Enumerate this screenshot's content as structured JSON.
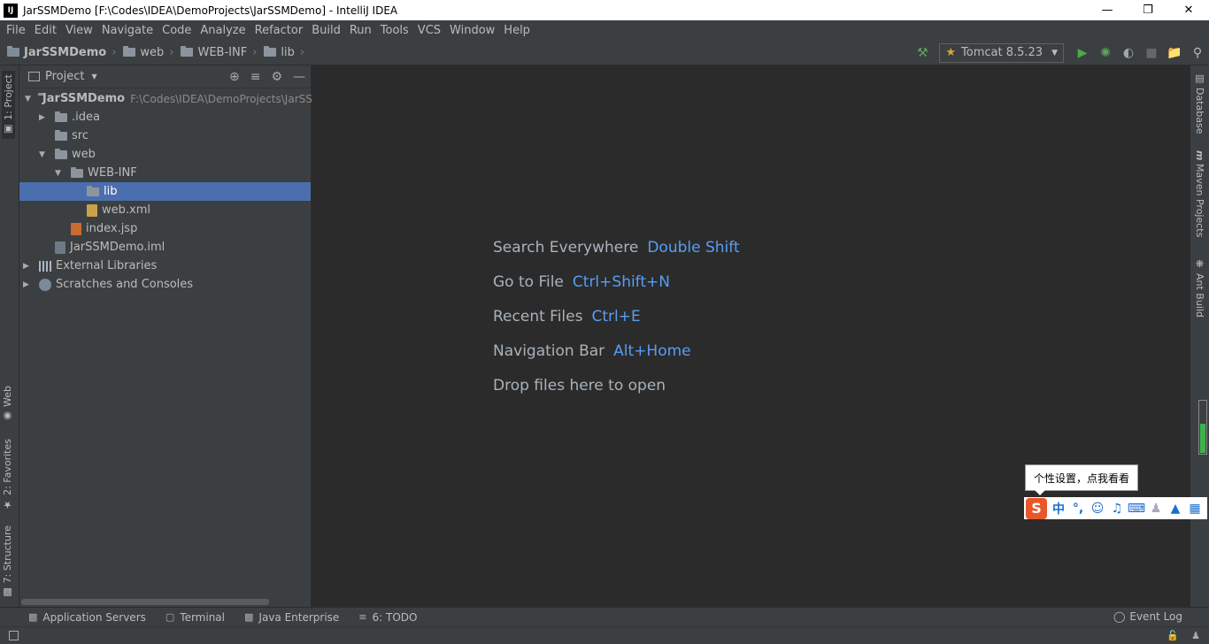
{
  "window": {
    "title": "JarSSMDemo [F:\\Codes\\IDEA\\DemoProjects\\JarSSMDemo] - IntelliJ IDEA",
    "app_icon": "IJ"
  },
  "menu": [
    "File",
    "Edit",
    "View",
    "Navigate",
    "Code",
    "Analyze",
    "Refactor",
    "Build",
    "Run",
    "Tools",
    "VCS",
    "Window",
    "Help"
  ],
  "breadcrumbs": [
    "JarSSMDemo",
    "web",
    "WEB-INF",
    "lib"
  ],
  "run_config": {
    "label": "Tomcat 8.5.23"
  },
  "left_tabs": {
    "project": "1: Project",
    "web": "Web",
    "favorites": "2: Favorites",
    "structure": "7: Structure"
  },
  "right_tabs": {
    "database": "Database",
    "maven": "Maven Projects",
    "ant": "Ant Build"
  },
  "project_panel": {
    "title": "Project",
    "tree": [
      {
        "label": "JarSSMDemo",
        "path": "F:\\Codes\\IDEA\\DemoProjects\\JarSS",
        "bold": true
      },
      {
        "label": ".idea"
      },
      {
        "label": "src"
      },
      {
        "label": "web"
      },
      {
        "label": "WEB-INF"
      },
      {
        "label": "lib",
        "selected": true
      },
      {
        "label": "web.xml"
      },
      {
        "label": "index.jsp"
      },
      {
        "label": "JarSSMDemo.iml"
      },
      {
        "label": "External Libraries"
      },
      {
        "label": "Scratches and Consoles"
      }
    ]
  },
  "editor_hints": [
    {
      "text": "Search Everywhere",
      "key": "Double Shift"
    },
    {
      "text": "Go to File",
      "key": "Ctrl+Shift+N"
    },
    {
      "text": "Recent Files",
      "key": "Ctrl+E"
    },
    {
      "text": "Navigation Bar",
      "key": "Alt+Home"
    },
    {
      "text": "Drop files here to open",
      "key": ""
    }
  ],
  "ime": {
    "tooltip": "个性设置，点我看看",
    "logo": "S",
    "mode": "中",
    "punct": "°,"
  },
  "bottom_tabs": [
    {
      "label": "Application Servers"
    },
    {
      "label": "Terminal"
    },
    {
      "label": "Java Enterprise"
    },
    {
      "label": "6: TODO"
    }
  ],
  "event_log": "Event Log",
  "memory": {
    "used_fraction": 0.55
  },
  "colors": {
    "accent": "#589df6",
    "selection": "#4b6eaf",
    "run_green": "#3cb34a"
  }
}
